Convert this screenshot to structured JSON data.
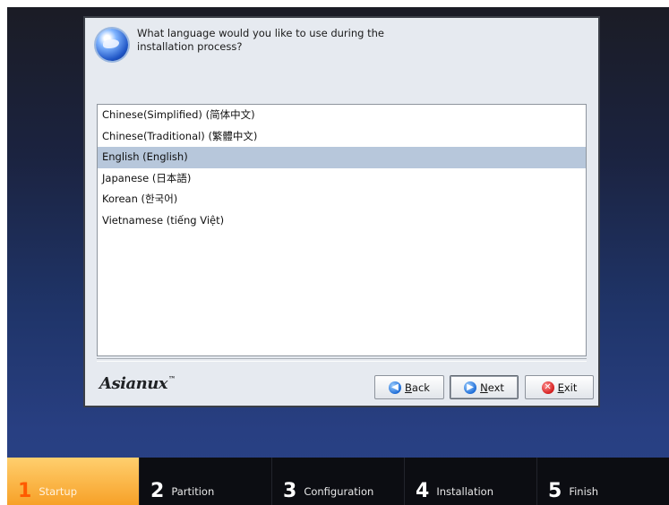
{
  "dialog": {
    "question": "What language would you like to use during the installation process?",
    "languages": [
      {
        "label": "Chinese(Simplified) (简体中文)",
        "selected": false
      },
      {
        "label": "Chinese(Traditional) (繁體中文)",
        "selected": false
      },
      {
        "label": "English (English)",
        "selected": true
      },
      {
        "label": "Japanese (日本語)",
        "selected": false
      },
      {
        "label": "Korean (한국어)",
        "selected": false
      },
      {
        "label": "Vietnamese (tiếng Việt)",
        "selected": false
      }
    ],
    "brand": "Asianux",
    "brand_mark": "™",
    "buttons": {
      "back_key": "B",
      "back_rest": "ack",
      "next_key": "N",
      "next_rest": "ext",
      "exit_key": "E",
      "exit_rest": "xit"
    }
  },
  "steps": [
    {
      "num": "1",
      "label": "Startup",
      "active": true
    },
    {
      "num": "2",
      "label": "Partition",
      "active": false
    },
    {
      "num": "3",
      "label": "Configuration",
      "active": false
    },
    {
      "num": "4",
      "label": "Installation",
      "active": false
    },
    {
      "num": "5",
      "label": "Finish",
      "active": false
    }
  ],
  "colors": {
    "selected_row": "#b7c7db",
    "active_step": "#f7a128"
  }
}
